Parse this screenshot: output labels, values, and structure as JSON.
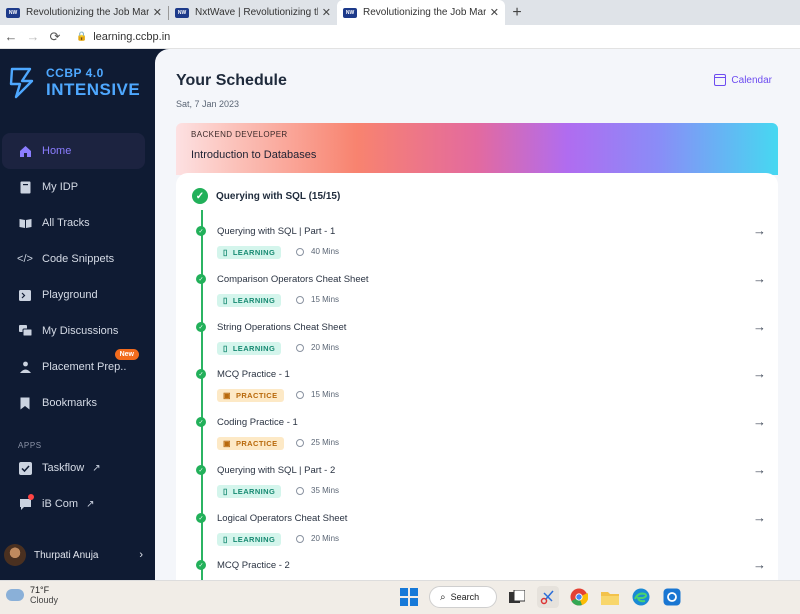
{
  "browser": {
    "tabs": [
      {
        "title": "Revolutionizing the Job Market |",
        "favicon": "NxtWave",
        "active": false
      },
      {
        "title": "NxtWave | Revolutionizing the Jo",
        "favicon": "NxtWave",
        "active": false
      },
      {
        "title": "Revolutionizing the Job Market |",
        "favicon": "NxtWave",
        "active": true
      }
    ],
    "close_glyph": "✕",
    "new_tab_glyph": "+",
    "url": "learning.ccbp.in"
  },
  "sidebar": {
    "logo_line1": "CCBP 4.0",
    "logo_line2": "INTENSIVE",
    "nav": [
      {
        "label": "Home",
        "icon": "home-icon",
        "active": true
      },
      {
        "label": "My IDP",
        "icon": "document-icon"
      },
      {
        "label": "All Tracks",
        "icon": "book-open-icon"
      },
      {
        "label": "Code Snippets",
        "icon": "code-icon"
      },
      {
        "label": "Playground",
        "icon": "terminal-icon"
      },
      {
        "label": "My Discussions",
        "icon": "discussion-icon"
      },
      {
        "label": "Placement Prep..",
        "icon": "placement-icon",
        "badge": "New"
      },
      {
        "label": "Bookmarks",
        "icon": "bookmark-icon"
      }
    ],
    "apps_title": "APPS",
    "apps": [
      {
        "label": "Taskflow",
        "icon": "taskflow-icon"
      },
      {
        "label": "iB Com",
        "icon": "chat-icon"
      }
    ],
    "user_name": "Thurpati Anuja"
  },
  "main": {
    "title": "Your Schedule",
    "date": "Sat, 7 Jan 2023",
    "calendar_label": "Calendar",
    "banner_subtitle": "BACKEND DEVELOPER",
    "banner_title": "Introduction to Databases",
    "module_title": "Querying with SQL (15/15)",
    "items": [
      {
        "name": "Querying with SQL | Part - 1",
        "tag": "LEARNING",
        "duration": "40 Mins"
      },
      {
        "name": "Comparison Operators Cheat Sheet",
        "tag": "LEARNING",
        "duration": "15 Mins"
      },
      {
        "name": "String Operations Cheat Sheet",
        "tag": "LEARNING",
        "duration": "20 Mins"
      },
      {
        "name": "MCQ Practice - 1",
        "tag": "PRACTICE",
        "duration": "15 Mins"
      },
      {
        "name": "Coding Practice - 1",
        "tag": "PRACTICE",
        "duration": "25 Mins"
      },
      {
        "name": "Querying with SQL | Part - 2",
        "tag": "LEARNING",
        "duration": "35 Mins"
      },
      {
        "name": "Logical Operators Cheat Sheet",
        "tag": "LEARNING",
        "duration": "20 Mins"
      },
      {
        "name": "MCQ Practice - 2",
        "tag": "",
        "duration": ""
      }
    ]
  },
  "taskbar": {
    "temperature": "71°F",
    "condition": "Cloudy",
    "search_label": "Search"
  },
  "colors": {
    "accent": "#6d4cf0",
    "success": "#22b05a",
    "sidebar_bg": "#0f1b33"
  }
}
